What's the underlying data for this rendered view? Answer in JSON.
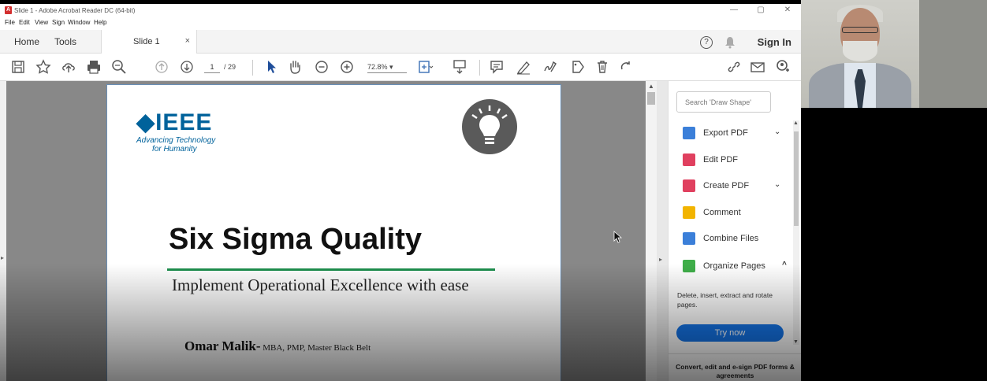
{
  "window": {
    "title": "Slide 1 - Adobe Acrobat Reader DC (64-bit)",
    "logo_glyph": "A",
    "minimize": "—",
    "maximize": "▢",
    "close": "✕"
  },
  "menu": [
    "File",
    "Edit",
    "View",
    "Sign",
    "Window",
    "Help"
  ],
  "tabs": {
    "home": "Home",
    "tools": "Tools",
    "doc": "Slide 1",
    "doc_close": "×",
    "help": "?",
    "bell": "🔔",
    "sign_in": "Sign In"
  },
  "toolbar": {
    "page_current": "1",
    "page_total": "/ 29",
    "zoom": "72.8%  ▾"
  },
  "slide": {
    "logo_text": "◆IEEE",
    "logo_tagline_1": "Advancing Technology",
    "logo_tagline_2": "for Humanity",
    "title": "Six Sigma Quality",
    "subtitle": "Implement Operational Excellence with ease",
    "author_name": "Omar Malik-",
    "author_creds": " MBA, PMP, Master Black Belt"
  },
  "panel": {
    "search_placeholder": "Search 'Draw Shape'",
    "items": [
      {
        "label": "Export PDF",
        "chevron": "⌄",
        "color": "#3b7fd9"
      },
      {
        "label": "Edit PDF",
        "chevron": "",
        "color": "#e0405f"
      },
      {
        "label": "Create PDF",
        "chevron": "⌄",
        "color": "#e0405f"
      },
      {
        "label": "Comment",
        "chevron": "",
        "color": "#f2b400"
      },
      {
        "label": "Combine Files",
        "chevron": "",
        "color": "#3b7fd9"
      },
      {
        "label": "Organize Pages",
        "chevron": "^",
        "color": "#3fae49"
      }
    ],
    "description": "Delete, insert, extract and rotate pages.",
    "try_now": "Try now",
    "promo": "Convert, edit and e-sign PDF forms & agreements"
  },
  "colors": {
    "ieee_blue": "#00629b",
    "title_rule": "#1e8f4e",
    "try_now_blue": "#1473e6",
    "acrobat_red": "#d32f2f"
  }
}
